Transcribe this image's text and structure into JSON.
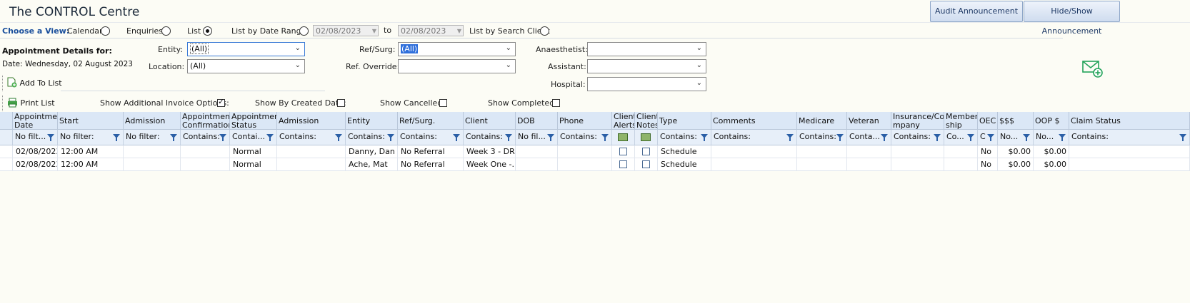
{
  "app": {
    "title": "The CONTROL Centre"
  },
  "header_buttons": {
    "audit": "Audit Announcement",
    "hide_show": "Hide/Show Announcement"
  },
  "view": {
    "label": "Choose a View:",
    "options": {
      "calendar": "Calendar",
      "enquiries": "Enquiries",
      "list": "List",
      "by_date": "List by Date Range:",
      "by_client": "List by Search Client"
    },
    "selected": "List",
    "date_from": "02/08/2023",
    "to_label": "to",
    "date_to": "02/08/2023"
  },
  "details": {
    "heading": "Appointment Details for:",
    "date_text": "Date: Wednesday, 02 August 2023"
  },
  "filters": {
    "entity_label": "Entity:",
    "entity_value": "(All)",
    "location_label": "Location:",
    "location_value": "(All)",
    "refsurg_label": "Ref/Surg:",
    "refsurg_value": "(All)",
    "refoverride_label": "Ref. Override:",
    "refoverride_value": "",
    "anaesthetist_label": "Anaesthetist:",
    "anaesthetist_value": "",
    "assistant_label": "Assistant:",
    "assistant_value": "",
    "hospital_label": "Hospital:",
    "hospital_value": ""
  },
  "toolbar": {
    "add_to_list": "Add To List",
    "print_list": "Print List"
  },
  "options": {
    "invoice": "Show Additional Invoice Options:",
    "invoice_checked": true,
    "created": "Show By Created Date:",
    "created_checked": false,
    "cancelled": "Show Cancelled:",
    "cancelled_checked": false,
    "completed": "Show Completed:",
    "completed_checked": false
  },
  "grid": {
    "columns": [
      "",
      "Appointment Date",
      "Start",
      "Admission Time",
      "Appointment Confirmation",
      "Appointment Status",
      "Admission Status",
      "Entity",
      "Ref/Surg.",
      "Client",
      "DOB",
      "Phone",
      "Client Alerts",
      "Client Notes",
      "Type",
      "Comments",
      "Medicare No.",
      "Veteran No.",
      "Insurance/Co mpany",
      "Member ship No.",
      "OEC",
      "$$$",
      "OOP $",
      "Claim Status"
    ],
    "filters": [
      "",
      "No filt...",
      "No filter:",
      "No filter:",
      "Contains:",
      "Contai...",
      "Contains:",
      "Contains:",
      "Contains:",
      "Contains:",
      "No fil...",
      "Contains:",
      "",
      "",
      "Contains:",
      "Contains:",
      "Contains:",
      "Conta...",
      "Contains:",
      "Co...",
      "C",
      "No...",
      "No...",
      "Contains:"
    ],
    "rows": [
      [
        "",
        "02/08/2023",
        "12:00 AM",
        "",
        "",
        "Normal",
        "",
        "Danny, Dan",
        "No Referral",
        "Week 3 - DR,",
        "",
        "",
        "",
        "",
        "Schedule",
        "",
        "",
        "",
        "",
        "",
        "No",
        "$0.00",
        "$0.00",
        ""
      ],
      [
        "",
        "02/08/2023",
        "12:00 AM",
        "",
        "",
        "Normal",
        "",
        "Ache, Mat",
        "No Referral",
        "Week One -...",
        "",
        "",
        "",
        "",
        "Schedule",
        "",
        "",
        "",
        "",
        "",
        "No",
        "$0.00",
        "$0.00",
        ""
      ]
    ]
  }
}
